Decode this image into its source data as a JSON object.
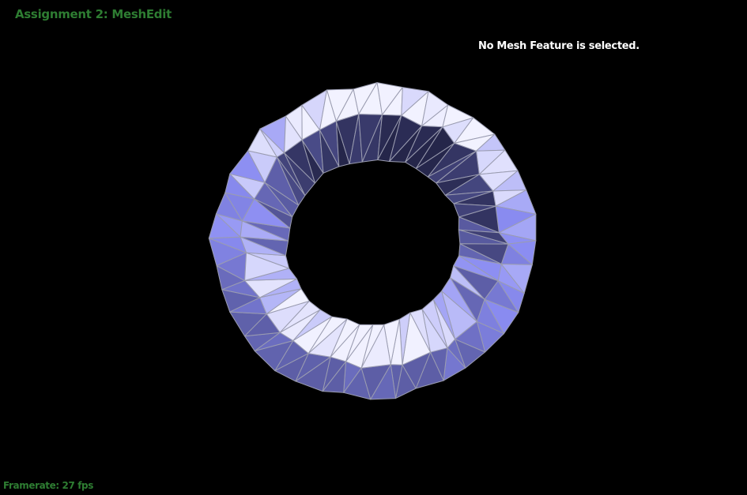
{
  "app": {
    "title": "Assignment 2: MeshEdit"
  },
  "status": {
    "selection": "No Mesh Feature is selected."
  },
  "footer": {
    "framerate_text": "Framerate: 27 fps"
  },
  "viewport": {
    "background_color": "#000000",
    "mesh_fill_light": "#f2f2ff",
    "mesh_fill_mid": "#8a8cf2",
    "mesh_fill_dark": "#25264a",
    "mesh_edge_color": "#9a9cb0",
    "ui_text_color": "#2e7d32"
  }
}
